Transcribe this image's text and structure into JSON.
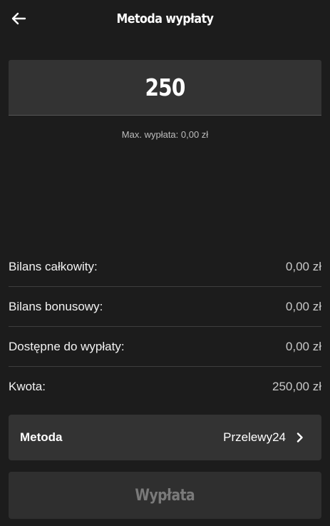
{
  "header": {
    "title": "Metoda wypłaty",
    "back_icon": "arrow-left-icon"
  },
  "amount": {
    "value": "250",
    "max_note": "Max. wypłata: 0,00 zł"
  },
  "summary": {
    "rows": [
      {
        "label": "Bilans całkowity:",
        "value": "0,00 zł"
      },
      {
        "label": "Bilans bonusowy:",
        "value": "0,00 zł"
      },
      {
        "label": "Dostępne do wypłaty:",
        "value": "0,00 zł"
      },
      {
        "label": "Kwota:",
        "value": "250,00 zł"
      }
    ]
  },
  "method": {
    "label": "Metoda",
    "value": "Przelewy24",
    "chevron_icon": "chevron-right-icon"
  },
  "submit": {
    "label": "Wypłata",
    "state": "disabled"
  },
  "colors": {
    "background": "#1c1c1c",
    "card": "#333333",
    "text": "#ffffff",
    "muted": "#c8c8c8",
    "disabled_text": "#7a7a7a"
  }
}
